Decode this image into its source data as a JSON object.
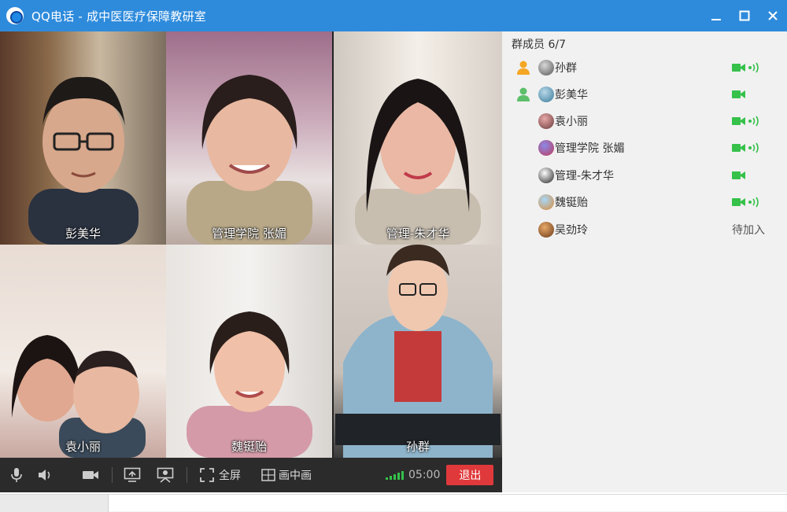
{
  "titlebar": {
    "title": "QQ电话 - 成中医医疗保障教研室",
    "minimize_icon": "minimize-icon",
    "maximize_icon": "maximize-icon",
    "close_icon": "close-icon",
    "color": "#2e8bdc"
  },
  "videos": [
    {
      "name": "彭美华"
    },
    {
      "name": "管理学院 张媚"
    },
    {
      "name": "管理-朱才华"
    },
    {
      "name": "袁小丽"
    },
    {
      "name": "魏铤贻"
    },
    {
      "name": "孙群"
    }
  ],
  "toolbar": {
    "mic_icon": "microphone-icon",
    "speaker_icon": "speaker-icon",
    "camera_icon": "camera-icon",
    "share_icon": "screen-share-icon",
    "presenter_icon": "presenter-icon",
    "fullscreen_icon": "fullscreen-icon",
    "fullscreen_label": "全屏",
    "pip_icon": "picture-in-picture-icon",
    "pip_label": "画中画",
    "signal_icon": "signal-strength-icon",
    "timer": "05:00",
    "exit_label": "退出",
    "exit_color": "#e0393b"
  },
  "members": {
    "header": "群成员 6/7",
    "list": [
      {
        "name": "孙群",
        "role_icon": "owner-icon",
        "camera": true,
        "speaking": true,
        "status": ""
      },
      {
        "name": "彭美华",
        "role_icon": "admin-icon",
        "camera": true,
        "speaking": false,
        "status": ""
      },
      {
        "name": "袁小丽",
        "role_icon": "",
        "camera": true,
        "speaking": true,
        "status": ""
      },
      {
        "name": "管理学院 张媚",
        "role_icon": "",
        "camera": true,
        "speaking": true,
        "status": ""
      },
      {
        "name": "管理-朱才华",
        "role_icon": "",
        "camera": true,
        "speaking": false,
        "status": ""
      },
      {
        "name": "魏铤贻",
        "role_icon": "",
        "camera": true,
        "speaking": true,
        "status": ""
      },
      {
        "name": "吴劲玲",
        "role_icon": "",
        "camera": false,
        "speaking": false,
        "status": "待加入"
      }
    ],
    "accent": "#35c14a"
  }
}
